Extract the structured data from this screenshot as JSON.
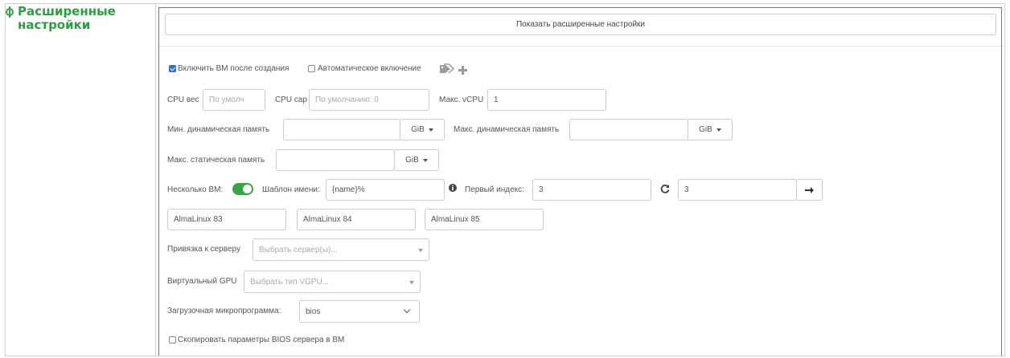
{
  "section": {
    "title": "Расширенные настройки"
  },
  "show_advanced_button": "Показать расширенные настройки",
  "checkboxes": {
    "power_on_after_create": {
      "label": "Включить ВМ после создания",
      "checked": true
    },
    "auto_power_on": {
      "label": "Автоматическое включение",
      "checked": false
    },
    "copy_bios": {
      "label": "Скопировать параметры BIOS сервера в ВМ",
      "checked": false
    }
  },
  "cpu": {
    "weight_label": "CPU вес",
    "weight_placeholder": "По умолч",
    "cap_label": "CPU cap",
    "cap_placeholder": "По умолчанию: 0",
    "max_vcpu_label": "Макс. vCPU",
    "max_vcpu_value": "1"
  },
  "memory": {
    "min_dynamic_label": "Мин. динамическая память",
    "min_dynamic_unit": "GiB",
    "max_dynamic_label": "Макс. динамическая память",
    "max_dynamic_unit": "GiB",
    "max_static_label": "Макс. статическая память",
    "max_static_unit": "GiB"
  },
  "multi_vm": {
    "label": "Несколько ВМ:",
    "enabled": true,
    "name_template_label": "Шаблон имени:",
    "name_template_value": "{name}%",
    "first_index_label": "Первый индекс:",
    "first_index_value": "3",
    "count_value": "3"
  },
  "vm_names": [
    "AlmaLinux 83",
    "AlmaLinux 84",
    "AlmaLinux 85"
  ],
  "server_affinity": {
    "label": "Привязка к серверу",
    "placeholder": "Выбрать сервер(ы)..."
  },
  "virtual_gpu": {
    "label": "Виртуальный GPU",
    "placeholder": "Выбрать тип VGPU..."
  },
  "boot_firmware": {
    "label": "Загрузочная микропрограмма:",
    "value": "bios"
  },
  "colors": {
    "accent": "#3aa34a",
    "checkbox": "#2d74c7"
  }
}
